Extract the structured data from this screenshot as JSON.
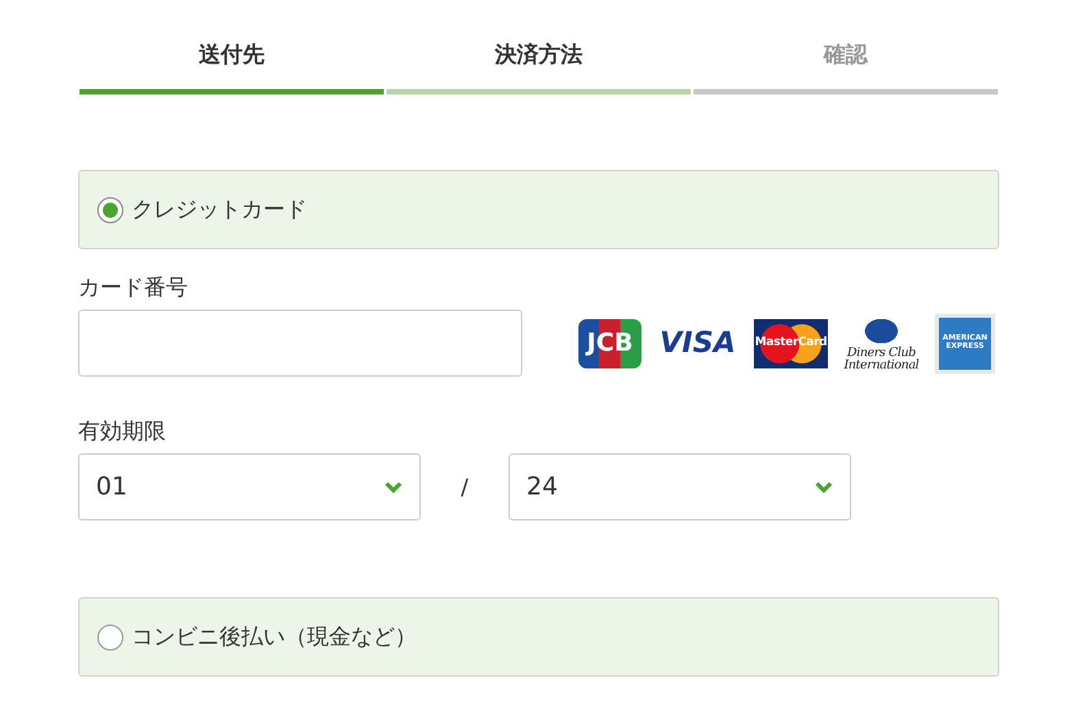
{
  "steps": [
    {
      "label": "送付先",
      "selected": false
    },
    {
      "label": "決済方法",
      "selected": true
    },
    {
      "label": "確認",
      "selected": false
    }
  ],
  "payment_options": [
    {
      "label": "クレジットカード",
      "selected": true
    },
    {
      "label": "コンビニ後払い（現金など）",
      "selected": false
    }
  ],
  "card_number": {
    "label": "カード番号"
  },
  "card_brands": [
    {
      "kind": "jcb",
      "lines": [
        "JCB"
      ]
    },
    {
      "kind": "visa",
      "lines": [
        "VISA"
      ]
    },
    {
      "kind": "mastercard",
      "lines": [
        "MasterCard"
      ]
    },
    {
      "kind": "diners",
      "lines": [
        "Diners Club",
        "International"
      ]
    },
    {
      "kind": "amex",
      "lines": [
        "AMERICAN",
        "EXPRESS"
      ]
    }
  ],
  "expiry": {
    "label": "有効期限",
    "month": "01",
    "separator": "/",
    "year": "24"
  }
}
